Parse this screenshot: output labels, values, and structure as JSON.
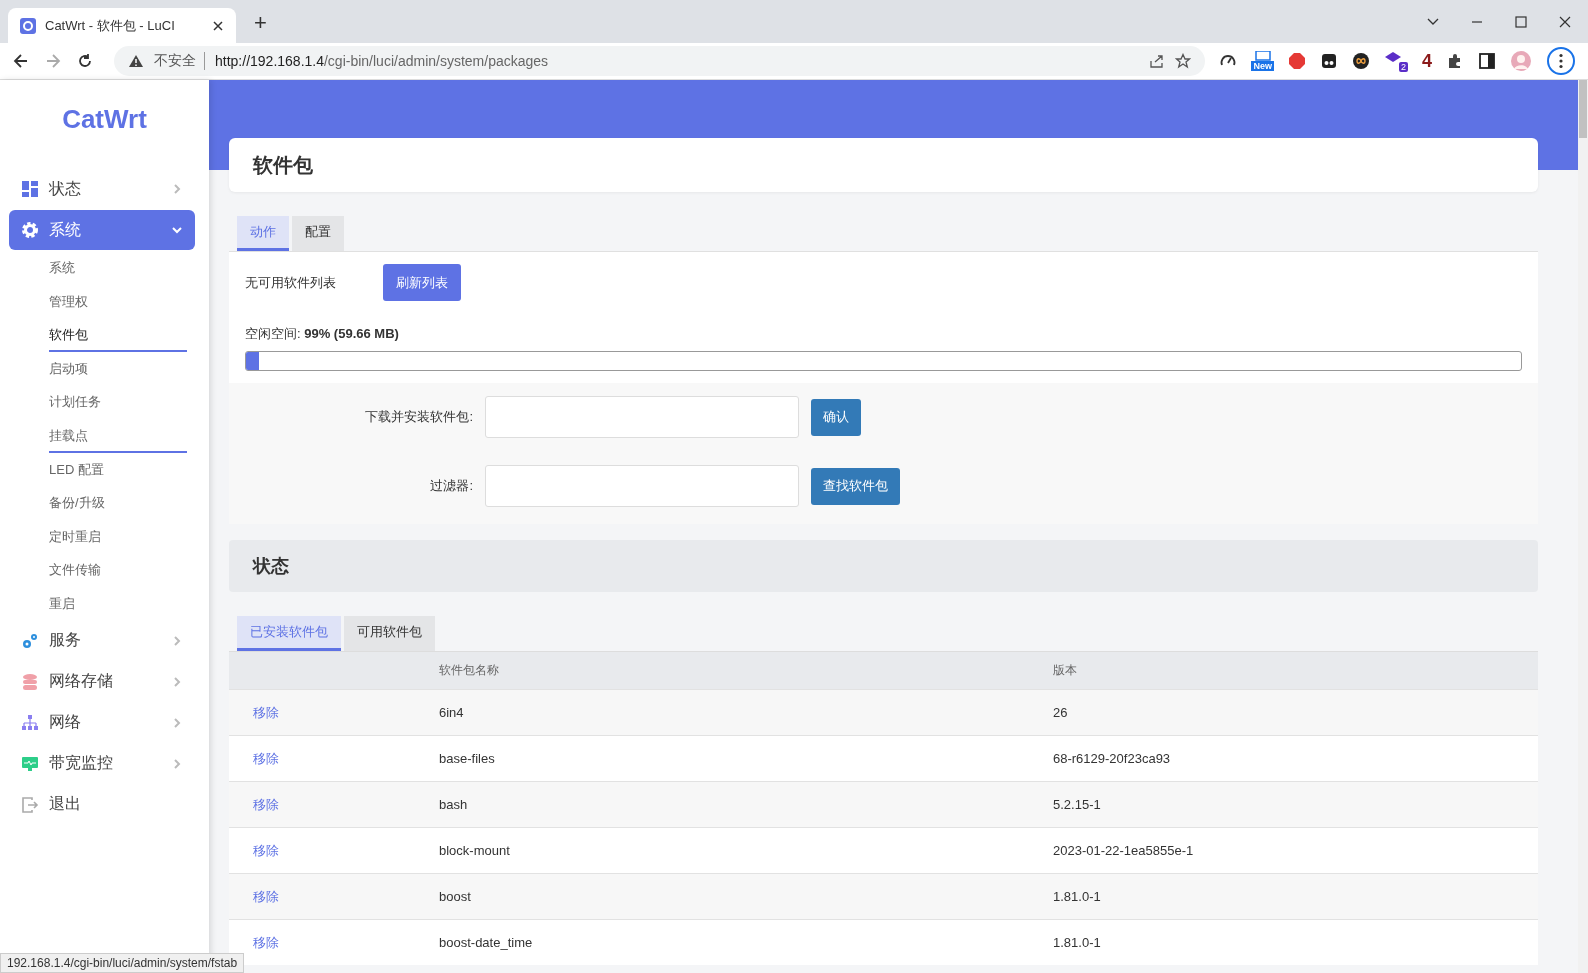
{
  "browser": {
    "tab_title": "CatWrt - 软件包 - LuCI",
    "new_tab": "+",
    "security": "不安全",
    "url_host": "http://192.168.1.4",
    "url_path": "/cgi-bin/luci/admin/system/packages",
    "ext_badge_new": "New",
    "ext_badge_count": "2",
    "ext_number": "4"
  },
  "sidebar": {
    "logo": "CatWrt",
    "items": [
      {
        "label": "状态",
        "selected": false,
        "expanded": false
      },
      {
        "label": "系统",
        "selected": true,
        "expanded": true,
        "children": [
          {
            "label": "系统",
            "selected": false,
            "hovered": false
          },
          {
            "label": "管理权",
            "selected": false,
            "hovered": false
          },
          {
            "label": "软件包",
            "selected": true,
            "hovered": false
          },
          {
            "label": "启动项",
            "selected": false,
            "hovered": false
          },
          {
            "label": "计划任务",
            "selected": false,
            "hovered": false
          },
          {
            "label": "挂载点",
            "selected": false,
            "hovered": true
          },
          {
            "label": "LED 配置",
            "selected": false,
            "hovered": false
          },
          {
            "label": "备份/升级",
            "selected": false,
            "hovered": false
          },
          {
            "label": "定时重启",
            "selected": false,
            "hovered": false
          },
          {
            "label": "文件传输",
            "selected": false,
            "hovered": false
          },
          {
            "label": "重启",
            "selected": false,
            "hovered": false
          }
        ]
      },
      {
        "label": "服务",
        "selected": false,
        "expanded": false
      },
      {
        "label": "网络存储",
        "selected": false,
        "expanded": false
      },
      {
        "label": "网络",
        "selected": false,
        "expanded": false
      },
      {
        "label": "带宽监控",
        "selected": false,
        "expanded": false
      },
      {
        "label": "退出",
        "selected": false
      }
    ]
  },
  "page": {
    "title": "软件包",
    "tabs": [
      {
        "label": "动作",
        "selected": true
      },
      {
        "label": "配置",
        "selected": false
      }
    ],
    "no_list": "无可用软件列表",
    "refresh_button": "刷新列表",
    "free_space_label": "空闲空间: ",
    "free_space_value": "99% (59.66 MB)",
    "used": {
      "level": 0.01
    },
    "install_label": "下载并安装软件包:",
    "install_button": "确认",
    "filter_label": "过滤器:",
    "filter_button": "查找软件包",
    "status_title": "状态",
    "status_tabs": [
      {
        "label": "已安装软件包",
        "selected": true
      },
      {
        "label": "可用软件包",
        "selected": false
      }
    ],
    "table": {
      "columns": [
        "软件包名称",
        "版本"
      ],
      "rows": [
        {
          "action": "移除",
          "name": "6in4",
          "version": "26"
        },
        {
          "action": "移除",
          "name": "base-files",
          "version": "68-r6129-20f23ca93"
        },
        {
          "action": "移除",
          "name": "bash",
          "version": "5.2.15-1"
        },
        {
          "action": "移除",
          "name": "block-mount",
          "version": "2023-01-22-1ea5855e-1"
        },
        {
          "action": "移除",
          "name": "boost",
          "version": "1.81.0-1"
        },
        {
          "action": "移除",
          "name": "boost-date_time",
          "version": "1.81.0-1"
        }
      ]
    }
  },
  "status_bar": "192.168.1.4/cgi-bin/luci/admin/system/fstab"
}
